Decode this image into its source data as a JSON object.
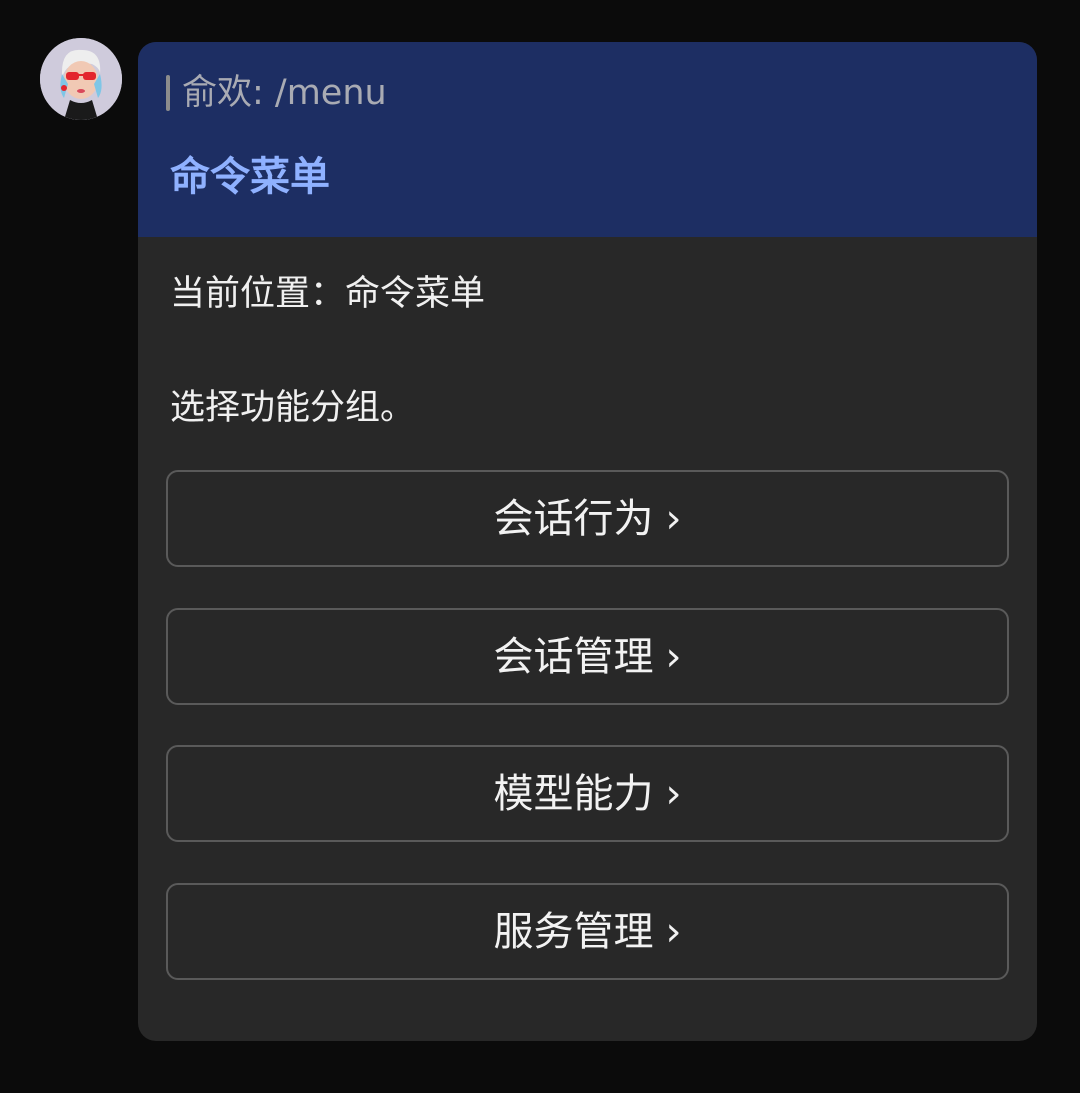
{
  "avatar": {
    "icon": "user-avatar-icon"
  },
  "card": {
    "quote_text": "俞欢: /menu",
    "title": "命令菜单",
    "location": "当前位置：命令菜单",
    "hint": "选择功能分组。",
    "buttons": [
      {
        "label": "会话行为",
        "chevron": "›"
      },
      {
        "label": "会话管理",
        "chevron": "›"
      },
      {
        "label": "模型能力",
        "chevron": "›"
      },
      {
        "label": "服务管理",
        "chevron": "›"
      }
    ]
  },
  "colors": {
    "background": "#0b0b0b",
    "card_background": "#282828",
    "header_background": "#1d2e63",
    "title_accent": "#8fb1ff",
    "button_border": "#5a5a5a"
  }
}
